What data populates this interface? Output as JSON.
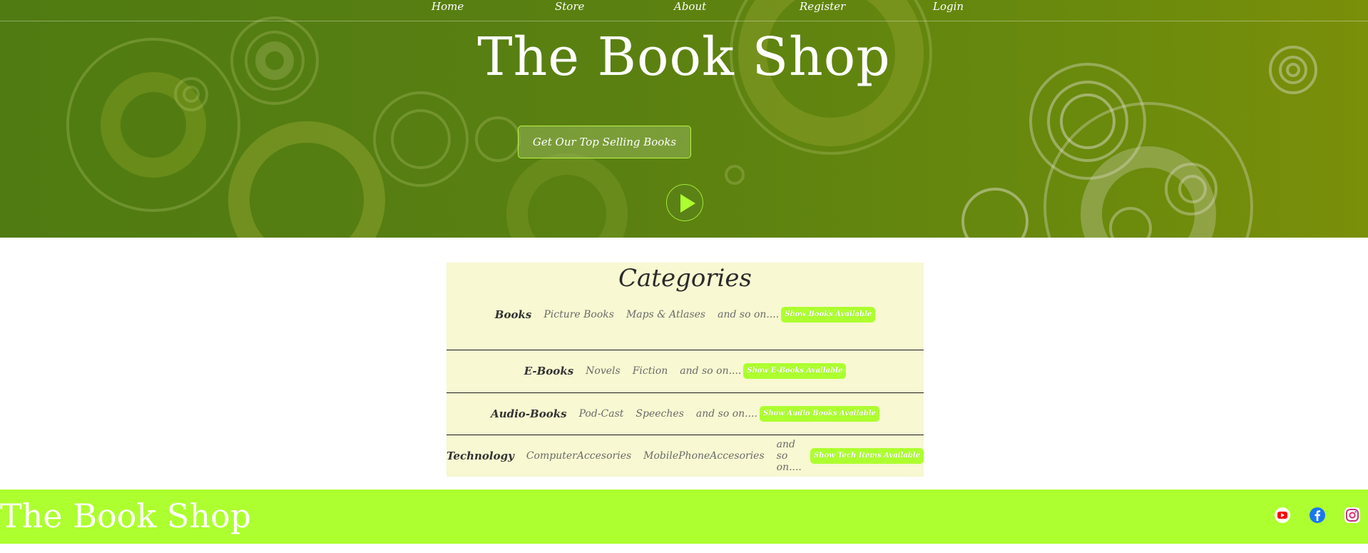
{
  "nav": {
    "items": [
      {
        "label": "Home"
      },
      {
        "label": "Store"
      },
      {
        "label": "About"
      },
      {
        "label": "Register"
      },
      {
        "label": "Login"
      }
    ]
  },
  "hero": {
    "title": "The Book Shop",
    "cta_label": "Get Our Top Selling Books",
    "play_icon": "play-icon"
  },
  "categories": {
    "heading": "Categories",
    "rows": [
      {
        "name": "Books",
        "subs": [
          "Picture Books",
          "Maps & Atlases",
          "and so on...."
        ],
        "button": "Show Books Available"
      },
      {
        "name": "E-Books",
        "subs": [
          "Novels",
          "Fiction",
          "and so on...."
        ],
        "button": "Show E-Books Available"
      },
      {
        "name": "Audio-Books",
        "subs": [
          "Pod-Cast",
          "Speeches",
          "and so on...."
        ],
        "button": "Show Audio Books Available"
      },
      {
        "name": "Technology",
        "subs": [
          "ComputerAccesories",
          "MobilePhoneAccesories",
          "and so on...."
        ],
        "button": "Show Tech Items Available"
      }
    ]
  },
  "footer": {
    "logo": "The Book Shop",
    "social_icons": [
      "youtube-icon",
      "facebook-icon",
      "instagram-icon"
    ]
  },
  "colors": {
    "hero_green": "#4f7b12",
    "accent_lime": "#adff2f",
    "panel_cream": "#f8f8d2"
  }
}
